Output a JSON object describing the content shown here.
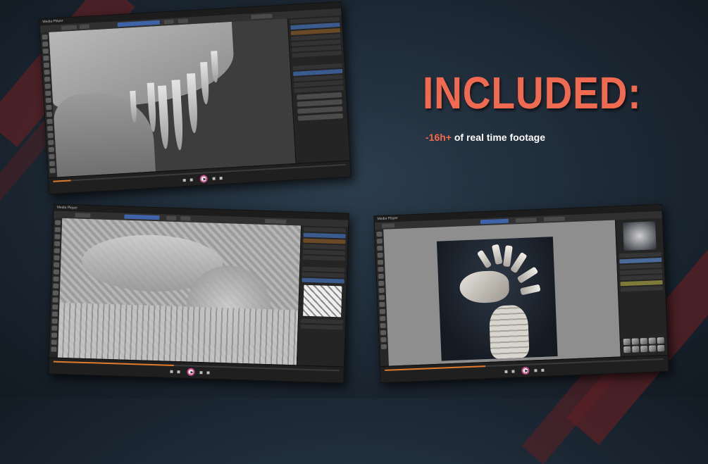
{
  "headline": "INCLUDED:",
  "feature": {
    "accent": "-16h+",
    "text": " of real time footage"
  },
  "windows": {
    "blender1_title": "Media Player",
    "blender2_title": "Media Player",
    "krita_title": "Media Player"
  },
  "colors": {
    "accent": "#f06a52",
    "background": "#1c2834",
    "stripe": "#5a2024",
    "progress": "#e07a2a",
    "selection": "#3b5a8e"
  }
}
